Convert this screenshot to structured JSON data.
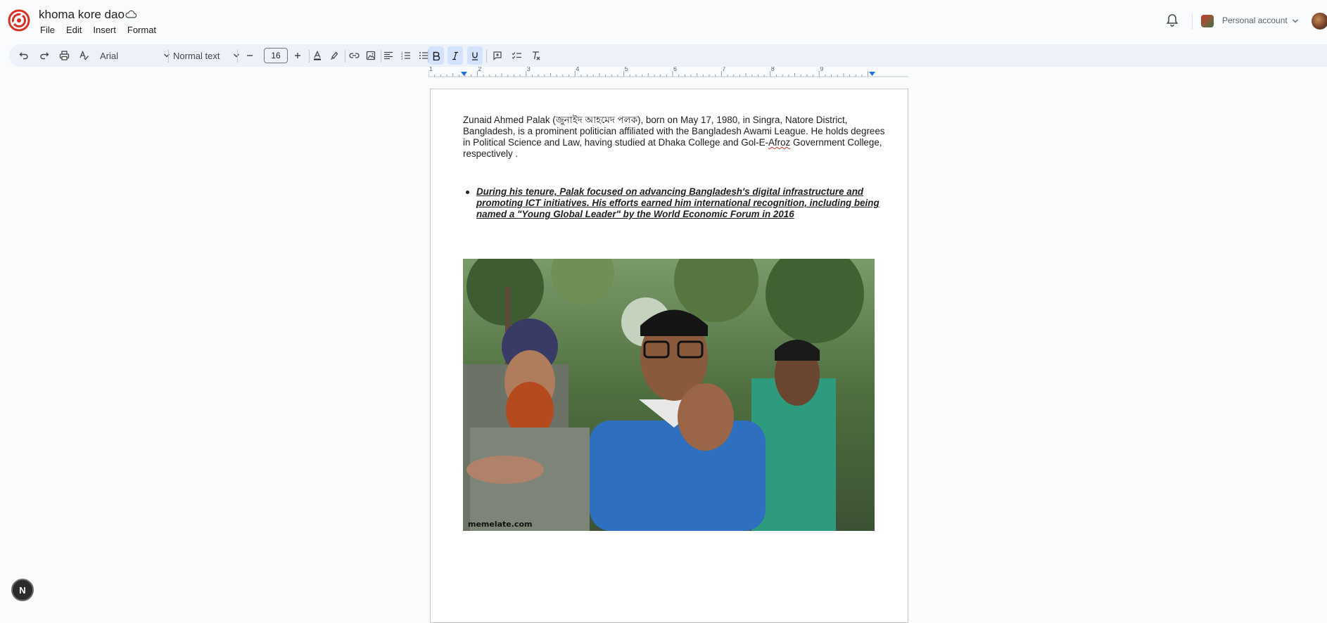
{
  "document": {
    "title": "khoma kore dao",
    "menu": [
      "File",
      "Edit",
      "Insert",
      "Format"
    ]
  },
  "account": {
    "label": "Personal account"
  },
  "toolbar": {
    "font": "Arial",
    "style": "Normal text",
    "font_size": "16"
  },
  "ruler": {
    "ticks": [
      "1",
      "2",
      "3",
      "4",
      "5",
      "6",
      "7",
      "8",
      "9"
    ]
  },
  "body": {
    "para_before": "Zunaid Ahmed Palak (জুনাইদ আহমেদ পলক), born on May 17, 1980, in Singra, Natore District, Bangladesh, is a prominent politician affiliated with the Bangladesh Awami League. He holds degrees in Political Science and Law, having studied at Dhaka College and Gol-E-",
    "para_misspelled": "Afroz",
    "para_after": " Government College, respectively .",
    "bullets": [
      "During his tenure, Palak focused on advancing Bangladesh's digital infrastructure and promoting ICT initiatives. His efforts earned him international recognition, including being named a \"Young Global Leader\" by the World Economic Forum in 2016"
    ],
    "image_watermark": "memelate.com"
  },
  "fab_label": "N",
  "colors": {
    "background": "#f9fbfd",
    "toolbar": "#edf2fa",
    "accent": "#1a73e8",
    "logo": "#d93025"
  }
}
